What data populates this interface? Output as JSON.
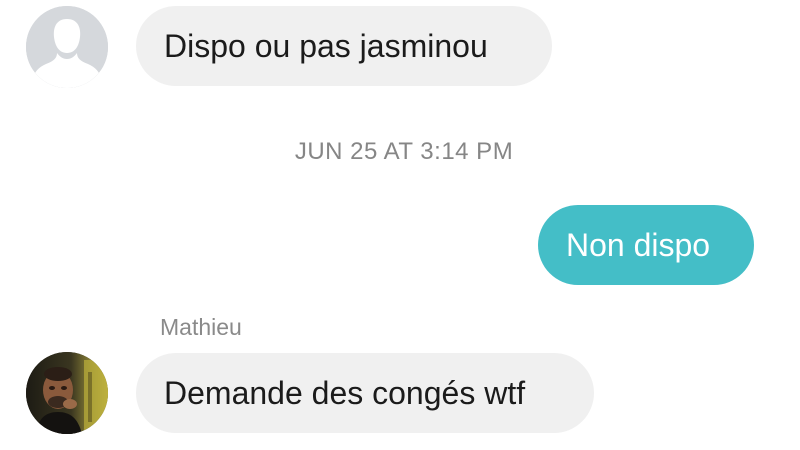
{
  "messages": [
    {
      "direction": "incoming",
      "avatar": "default-user-silhouette-icon",
      "text": "Dispo ou pas jasminou"
    },
    {
      "direction": "outgoing",
      "text": "Non dispo"
    },
    {
      "direction": "incoming",
      "sender": "Mathieu",
      "avatar": "user-photo-avatar",
      "text": "Demande des congés wtf"
    }
  ],
  "timestamp": "JUN 25 AT 3:14 PM",
  "colors": {
    "incoming_bubble": "#f0f0f0",
    "outgoing_bubble": "#44bec7",
    "text_dark": "#1b1b1b",
    "timestamp_gray": "#868686"
  }
}
